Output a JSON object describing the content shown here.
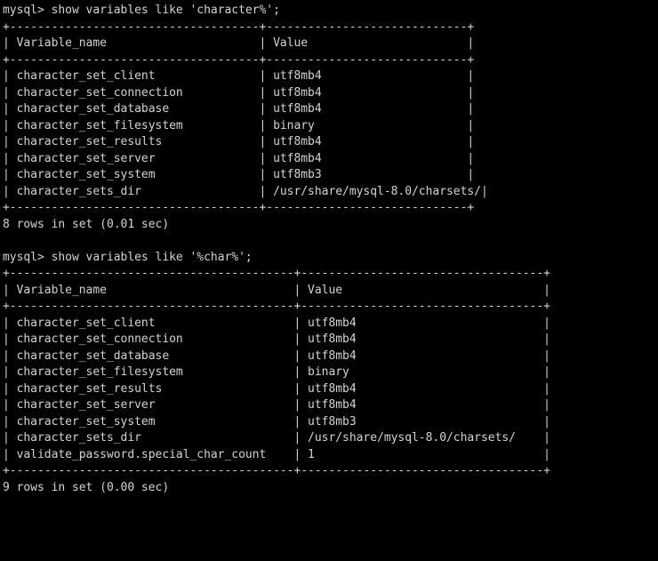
{
  "terminal": {
    "background_color": "#000000",
    "text_color": "#d4d4d4",
    "prompt": "mysql>"
  },
  "blocks": [
    {
      "name": "first-query-block",
      "command_line": "mysql> show variables like 'character%';",
      "command": "show variables like 'character%';",
      "table": {
        "name_column_width": 36,
        "value_column_width": 29,
        "headers": [
          "Variable_name",
          "Value"
        ],
        "rows": [
          [
            "character_set_client",
            "utf8mb4"
          ],
          [
            "character_set_connection",
            "utf8mb4"
          ],
          [
            "character_set_database",
            "utf8mb4"
          ],
          [
            "character_set_filesystem",
            "binary"
          ],
          [
            "character_set_results",
            "utf8mb4"
          ],
          [
            "character_set_server",
            "utf8mb4"
          ],
          [
            "character_set_system",
            "utf8mb3"
          ],
          [
            "character_sets_dir",
            "/usr/share/mysql-8.0/charsets/"
          ]
        ]
      },
      "result_line": "8 rows in set (0.01 sec)",
      "row_count": 8,
      "elapsed": "0.01 sec"
    },
    {
      "name": "second-query-block",
      "command_line": "mysql> show variables like '%char%';",
      "command": "show variables like '%char%';",
      "table": {
        "name_column_width": 41,
        "value_column_width": 35,
        "headers": [
          "Variable_name",
          "Value"
        ],
        "rows": [
          [
            "character_set_client",
            "utf8mb4"
          ],
          [
            "character_set_connection",
            "utf8mb4"
          ],
          [
            "character_set_database",
            "utf8mb4"
          ],
          [
            "character_set_filesystem",
            "binary"
          ],
          [
            "character_set_results",
            "utf8mb4"
          ],
          [
            "character_set_server",
            "utf8mb4"
          ],
          [
            "character_set_system",
            "utf8mb3"
          ],
          [
            "character_sets_dir",
            "/usr/share/mysql-8.0/charsets/"
          ],
          [
            "validate_password.special_char_count",
            "1"
          ]
        ]
      },
      "result_line": "9 rows in set (0.00 sec)",
      "row_count": 9,
      "elapsed": "0.00 sec"
    }
  ]
}
